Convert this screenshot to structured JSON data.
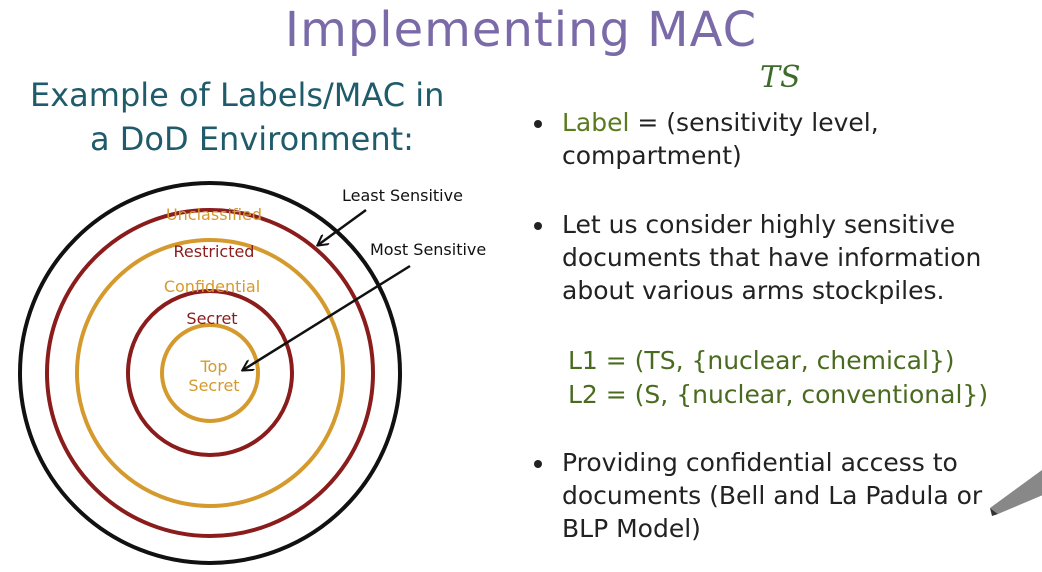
{
  "title": "Implementing MAC",
  "subtitle": {
    "line1": "Example of Labels/MAC in",
    "line2": "a DoD Environment:"
  },
  "annotation_ts": "TS",
  "diagram": {
    "rings": [
      {
        "label": "Unclassified",
        "color": "#d59a2e"
      },
      {
        "label": "Restricted",
        "color": "#8a1c1c"
      },
      {
        "label": "Confidential",
        "color": "#d59a2e"
      },
      {
        "label": "Secret",
        "color": "#8a1c1c"
      },
      {
        "label_line1": "Top",
        "label_line2": "Secret",
        "color": "#d59a2e"
      }
    ],
    "outer_color": "#111111",
    "least_sensitive": "Least Sensitive",
    "most_sensitive": "Most Sensitive"
  },
  "bullets": {
    "b1_term": "Label",
    "b1_rest_1": " = (sensitivity level,",
    "b1_rest_2": "compartment)",
    "b2_line1": "Let us consider highly sensitive",
    "b2_line2": "documents that have information",
    "b2_line3": "about various arms stockpiles.",
    "l1": "L1 = (TS, {nuclear, chemical})",
    "l2": "L2 = (S, {nuclear, conventional})",
    "b3_line1": "Providing confidential access to",
    "b3_line2": "documents (Bell and La Padula or",
    "b3_line3": "BLP Model)"
  },
  "colors": {
    "title": "#7b6aa8",
    "subtitle": "#1f5b6b",
    "green": "#4a6b1f",
    "gold": "#d59a2e",
    "maroon": "#8a1c1c"
  }
}
